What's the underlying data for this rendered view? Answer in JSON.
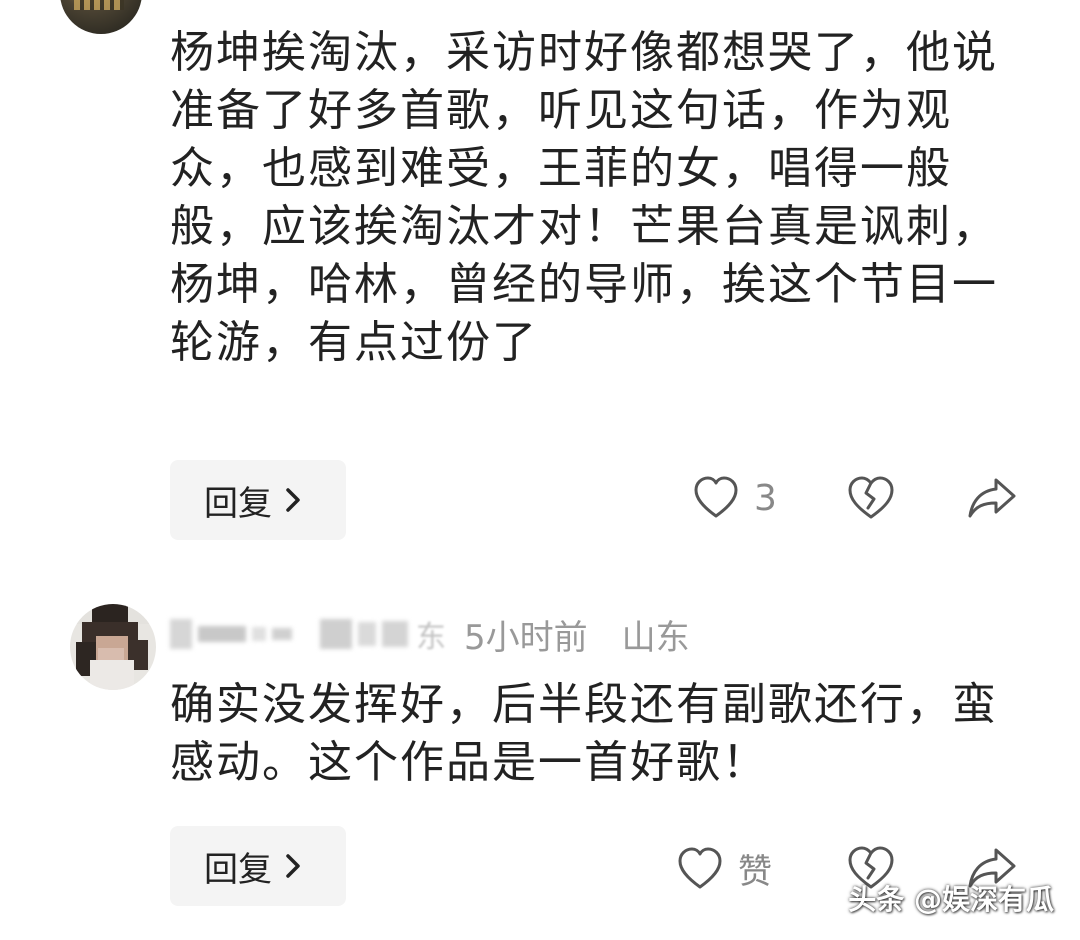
{
  "comments": [
    {
      "text": "杨坤挨淘汰，采访时好像都想哭了，他说准备了好多首歌，听见这句话，作为观众，也感到难受，王菲的女，唱得一般般，应该挨淘汰才对！芒果台真是讽刺，杨坤，哈林，曾经的导师，挨这个节目一轮游，有点过份了",
      "reply_label": "回复",
      "like_count": "3"
    },
    {
      "username_fragment": "东",
      "time": "5小时前",
      "location": "山东",
      "text": "确实没发挥好，后半段还有副歌还行，蛮感动。这个作品是一首好歌！",
      "reply_label": "回复",
      "like_label": "赞"
    }
  ],
  "watermark": "头条 @娱深有瓜",
  "icons": {
    "like": "heart-outline-icon",
    "dislike": "broken-heart-icon",
    "share": "share-arrow-icon",
    "reply_chevron": "chevron-right-icon"
  },
  "colors": {
    "text": "#222222",
    "meta": "#999999",
    "icon": "#555555",
    "reply_bg": "#f4f4f4"
  }
}
